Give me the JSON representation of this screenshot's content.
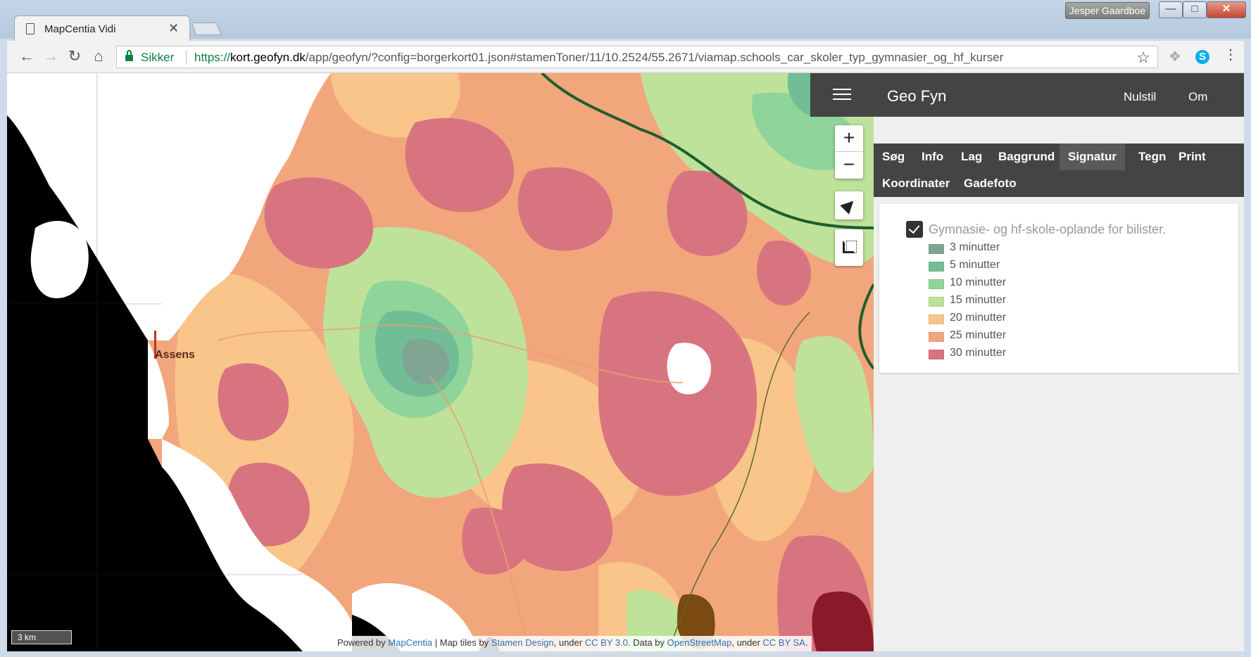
{
  "window": {
    "profile_name": "Jesper Gaardboe",
    "minimize": "—",
    "maximize": "□",
    "close": "✕"
  },
  "tab": {
    "title": "MapCentia Vidi",
    "close": "✕"
  },
  "address_bar": {
    "secure_label": "Sikker",
    "url_scheme": "https://",
    "url_host": "kort.geofyn.dk",
    "url_path": "/app/geofyn/?config=borgerkort01.json#stamenToner/11/10.2524/55.2671/viamap.schools_car_skoler_typ_gymnasier_og_hf_kurser"
  },
  "map": {
    "place_label": "Assens",
    "scale_text": "3 km",
    "attribution": {
      "powered_by": "Powered by ",
      "mapcentia": "MapCentia",
      "tiles_by": " | Map tiles by ",
      "stamen": "Stamen Design",
      "under1": ", under ",
      "ccby": "CC BY 3.0",
      "data_by": ". Data by ",
      "osm": "OpenStreetMap",
      "under2": ", under ",
      "ccbysa": "CC BY SA",
      "end": "."
    },
    "zoom_in": "+",
    "zoom_out": "−",
    "colors": {
      "water": "#000000",
      "land": "#ffffff",
      "m3": "#7fa693",
      "m5": "#72bd96",
      "m10": "#8fd49a",
      "m15": "#bfe29a",
      "m20": "#f9c58a",
      "m25": "#f2a67c",
      "m30": "#d8747f"
    }
  },
  "sidebar": {
    "title": "Geo Fyn",
    "reset": "Nulstil",
    "about": "Om",
    "tabs": [
      "Søg",
      "Info",
      "Lag",
      "Baggrund",
      "Signatur",
      "Tegn",
      "Print",
      "Koordinater",
      "Gadefoto"
    ],
    "active_tab": "Signatur",
    "layer_title": "Gymnasie- og hf-skole-oplande for bilister.",
    "legend": [
      {
        "label": "3 minutter",
        "color": "#7fa693"
      },
      {
        "label": "5 minutter",
        "color": "#72bd96"
      },
      {
        "label": "10 minutter",
        "color": "#8fd49a"
      },
      {
        "label": "15 minutter",
        "color": "#bfe29a"
      },
      {
        "label": "20 minutter",
        "color": "#f9c58a"
      },
      {
        "label": "25 minutter",
        "color": "#f2a67c"
      },
      {
        "label": "30 minutter",
        "color": "#d8747f"
      }
    ]
  }
}
